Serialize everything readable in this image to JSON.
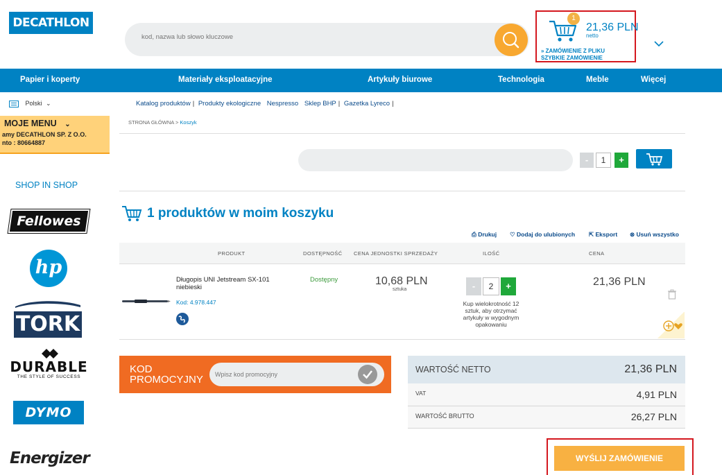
{
  "header": {
    "logo": "DECATHLON",
    "search_placeholder": "kod, nazwa lub słowo kluczowe",
    "cart": {
      "count": "1",
      "amount": "21,36 PLN",
      "netto": "netto",
      "link_file": "» ZAMÓWIENIE Z PLIKU",
      "link_quick": "SZYBKIE ZAMÓWIENIE"
    }
  },
  "nav": {
    "items": [
      "Papier i koperty",
      "Materiały eksploatacyjne",
      "Artykuły biurowe",
      "Technologia",
      "Meble",
      "Więcej"
    ]
  },
  "language": "Polski",
  "links": [
    "Katalog produktów",
    "Produkty ekologiczne",
    "Nespresso",
    "Sklep BHP",
    "Gazetka Lyreco"
  ],
  "sidebar": {
    "menu_title": "MOJE MENU",
    "line1": "amy DECATHLON SP. Z O.O.",
    "line2": "nto : 80664887",
    "shop_in_shop": "SHOP IN SHOP",
    "brands": [
      "Fellowes",
      "hp",
      "TORK",
      "DURABLE",
      "THE STYLE OF SUCCESS",
      "DYMO",
      "Energizer"
    ]
  },
  "breadcrumb": {
    "home": "STRONA GŁÓWNA",
    "sep": " > ",
    "current": "Koszyk"
  },
  "quick_order": {
    "qty": "1",
    "minus": "-",
    "plus": "+"
  },
  "cart_title": "1 produktów w moim koszyku",
  "actions": {
    "print": "Drukuj",
    "favorites": "Dodaj do ulubionych",
    "export": "Eksport",
    "remove_all": "Usuń wszystko"
  },
  "table": {
    "headers": {
      "product": "PRODUKT",
      "availability": "DOSTĘPNOŚĆ",
      "unit_price": "CENA JEDNOSTKI SPRZEDAŻY",
      "qty": "ILOŚĆ",
      "price": "CENA"
    },
    "row": {
      "name": "Długopis UNI Jetstream SX-101 niebieski",
      "code": "Kod: 4.978.447",
      "availability": "Dostępny",
      "unit_price": "10,68 PLN",
      "unit": "sztuka",
      "qty": "2",
      "multi_note": "Kup wielokrotność 12 sztuk, aby otrzymać artykuły w wygodnym opakowaniu",
      "price": "21,36 PLN"
    }
  },
  "promo": {
    "label_line1": "KOD",
    "label_line2": "PROMOCYJNY",
    "placeholder": "Wpisz kod promocyjny"
  },
  "totals": {
    "net_label": "WARTOŚĆ NETTO",
    "net_value": "21,36 PLN",
    "vat_label": "VAT",
    "vat_value": "4,91 PLN",
    "gross_label": "WARTOŚĆ BRUTTO",
    "gross_value": "26,27 PLN"
  },
  "send_button": "WYŚLIJ ZAMÓWIENIE",
  "colors": {
    "brand_blue": "#0082c3",
    "orange": "#f06b22",
    "cta": "#f8b142",
    "highlight_red": "#d4171e"
  }
}
